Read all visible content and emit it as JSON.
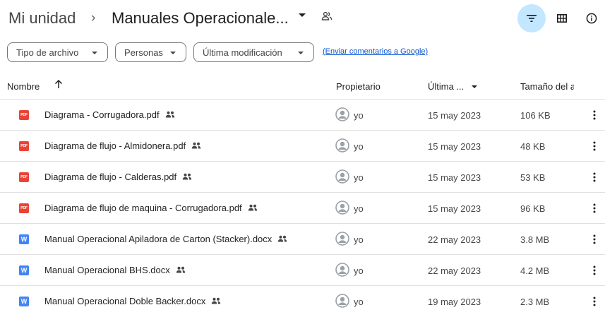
{
  "header": {
    "root_label": "Mi unidad",
    "separator": "›",
    "current_folder": "Manuales Operacionale..."
  },
  "filters": {
    "type_label": "Tipo de archivo",
    "people_label": "Personas",
    "modified_label": "Última modificación",
    "feedback_link": "(Enviar comentarios a Google)"
  },
  "table": {
    "columns": {
      "name": "Nombre",
      "owner": "Propietario",
      "modified": "Última ...",
      "size": "Tamaño del a"
    },
    "rows": [
      {
        "icon": "pdf-icon",
        "name": "Diagrama - Corrugadora.pdf",
        "owner": "yo",
        "modified": "15 may 2023",
        "size": "106 KB"
      },
      {
        "icon": "pdf-icon",
        "name": "Diagrama de flujo - Almidonera.pdf",
        "owner": "yo",
        "modified": "15 may 2023",
        "size": "48 KB"
      },
      {
        "icon": "pdf-icon",
        "name": "Diagrama de flujo - Calderas.pdf",
        "owner": "yo",
        "modified": "15 may 2023",
        "size": "53 KB"
      },
      {
        "icon": "pdf-icon",
        "name": "Diagrama de flujo de maquina - Corrugadora.pdf",
        "owner": "yo",
        "modified": "15 may 2023",
        "size": "96 KB"
      },
      {
        "icon": "word-icon",
        "name": "Manual Operacional Apiladora de Carton (Stacker).docx",
        "owner": "yo",
        "modified": "22 may 2023",
        "size": "3.8 MB"
      },
      {
        "icon": "word-icon",
        "name": "Manual Operacional BHS.docx",
        "owner": "yo",
        "modified": "22 may 2023",
        "size": "4.2 MB"
      },
      {
        "icon": "word-icon",
        "name": "Manual Operacional Doble Backer.docx",
        "owner": "yo",
        "modified": "19 may 2023",
        "size": "2.3 MB"
      }
    ]
  },
  "icons": {
    "pdf_label": "PDF",
    "word_label": "W"
  },
  "colors": {
    "active_filter_bg": "#c2e7ff",
    "pdf_red": "#ea4335",
    "word_blue": "#4285f4",
    "link_blue": "#0b57d0"
  }
}
